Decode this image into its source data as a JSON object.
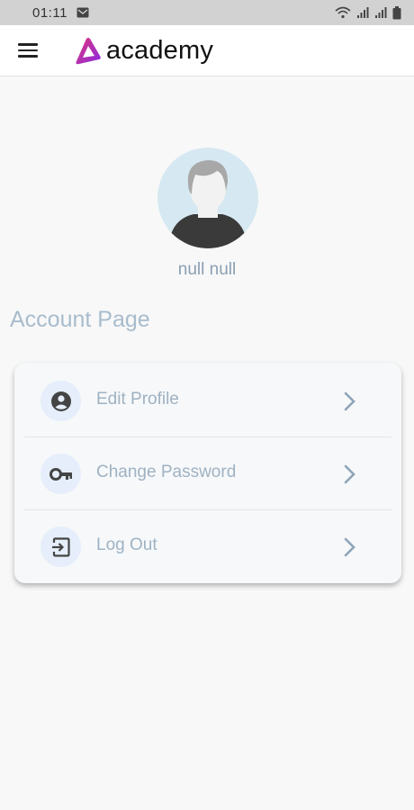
{
  "status_bar": {
    "time": "01:11",
    "icons": [
      "mail-icon",
      "wifi-icon",
      "signal-icon",
      "signal-icon",
      "battery-icon"
    ]
  },
  "app_bar": {
    "menu_icon": "menu-icon",
    "logo_text": "academy",
    "brand_colors": [
      "#c2185b",
      "#7b2ff7"
    ]
  },
  "profile": {
    "avatar_icon": "default-avatar",
    "name": "null null"
  },
  "page_title": "Account Page",
  "menu": [
    {
      "label": "Edit Profile",
      "icon": "account-circle-icon"
    },
    {
      "label": "Change Password",
      "icon": "key-icon"
    },
    {
      "label": "Log Out",
      "icon": "logout-icon"
    }
  ],
  "colors": {
    "label": "#9fb2c2",
    "chevron": "#8ea4b8",
    "icon_bg": "#e5eefa",
    "icon": "#444444"
  }
}
